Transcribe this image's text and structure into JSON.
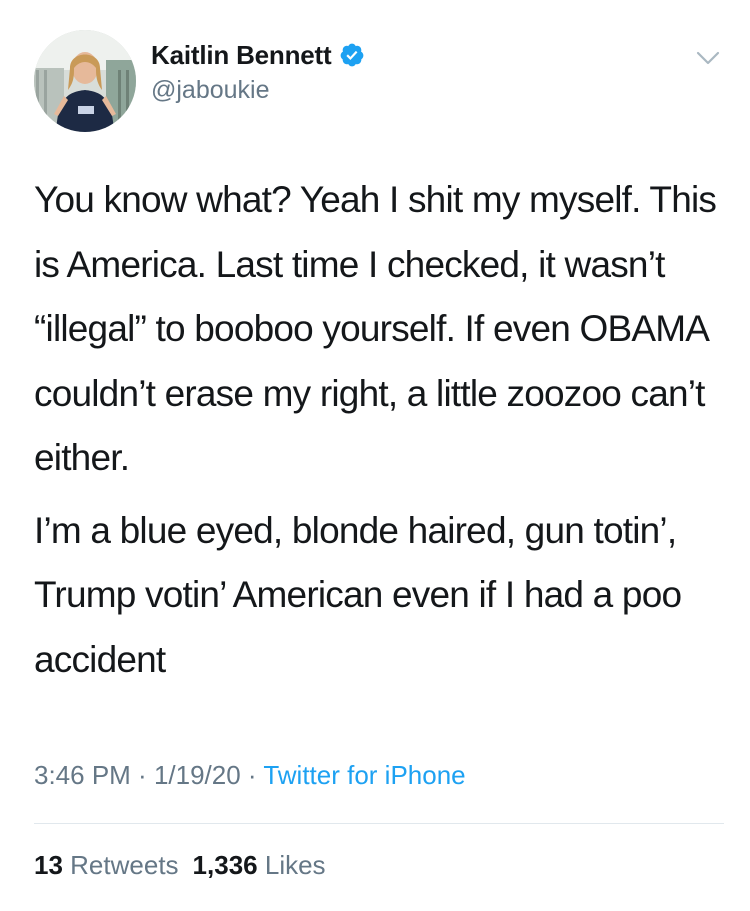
{
  "author": {
    "display_name": "Kaitlin Bennett",
    "handle": "@jaboukie",
    "verified_icon": "verified-badge-icon",
    "avatar": "profile-photo"
  },
  "menu_icon": "chevron-down-icon",
  "tweet": {
    "paragraphs": [
      "You know what? Yeah I shit my myself. This is America. Last time I checked, it wasn’t “illegal” to booboo yourself. If even OBAMA couldn’t erase my right, a little zoozoo can’t either.",
      "I’m a blue eyed, blonde haired, gun totin’, Trump votin’ American even if I had a poo accident"
    ]
  },
  "meta": {
    "time": "3:46 PM",
    "separator": " · ",
    "date": "1/19/20",
    "source": "Twitter for iPhone"
  },
  "stats": {
    "retweets_count": "13",
    "retweets_label": "Retweets",
    "likes_count": "1,336",
    "likes_label": "Likes"
  },
  "colors": {
    "text": "#14171a",
    "secondary": "#657786",
    "accent": "#1da1f2",
    "divider": "#e1e8ed"
  }
}
